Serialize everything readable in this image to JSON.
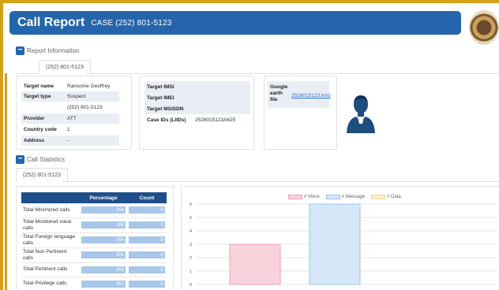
{
  "header": {
    "title": "Call Report",
    "case": "CASE (252) 801-5123"
  },
  "report_info": {
    "section_label": "Report Information",
    "tab": "(252) 801-5123"
  },
  "target_panel": {
    "rows": [
      {
        "key": "Target name",
        "value": "Ransome Geoffrey"
      },
      {
        "key": "Target type",
        "value": "Suspect"
      },
      {
        "key": "",
        "value": "(252) 801-5123"
      },
      {
        "key": "Provider",
        "value": "ATT"
      },
      {
        "key": "Country code",
        "value": "1"
      },
      {
        "key": "Address",
        "value": "-"
      }
    ]
  },
  "ids_panel": {
    "rows": [
      {
        "key": "Target IMSI",
        "value": ""
      },
      {
        "key": "Target IMEI",
        "value": ""
      },
      {
        "key": "Target MSISDN",
        "value": ""
      },
      {
        "key": "Case IDs (LIIDs)",
        "value": "2528015123A625"
      }
    ]
  },
  "google_panel": {
    "key": "Google earth file",
    "value": "2528015123.kmz"
  },
  "call_stats": {
    "section_label": "Call Statistics",
    "tab": "(252) 801-5123",
    "columns": [
      "",
      "Percentage",
      "Count"
    ],
    "rows": [
      {
        "label": "Total Minimized calls",
        "pct": "0%",
        "count": "0"
      },
      {
        "label": "Total Monitored voice calls",
        "pct": "0%",
        "count": "0"
      },
      {
        "label": "Total Foreign language calls",
        "pct": "0%",
        "count": "0"
      },
      {
        "label": "Total Non Pertinent calls",
        "pct": "0%",
        "count": "0"
      },
      {
        "label": "Total Pertinent calls",
        "pct": "0%",
        "count": "0"
      },
      {
        "label": "Total Privilege calls",
        "pct": "0%",
        "count": "0"
      }
    ]
  },
  "chart_data": {
    "type": "bar",
    "series": [
      {
        "name": "# Voice",
        "values": [
          3
        ],
        "color": "#f8d3dc",
        "border": "#f0a0b4"
      },
      {
        "name": "# Message",
        "values": [
          6
        ],
        "color": "#d6e8f7",
        "border": "#9cc6ea"
      },
      {
        "name": "# Data",
        "values": [
          0
        ],
        "color": "#fdf0cf",
        "border": "#f2d58a"
      }
    ],
    "ylim": [
      0,
      6
    ],
    "yticks": [
      "0",
      "1",
      "2",
      "3",
      "4",
      "5",
      "6"
    ],
    "grid": true,
    "legend": "top"
  }
}
